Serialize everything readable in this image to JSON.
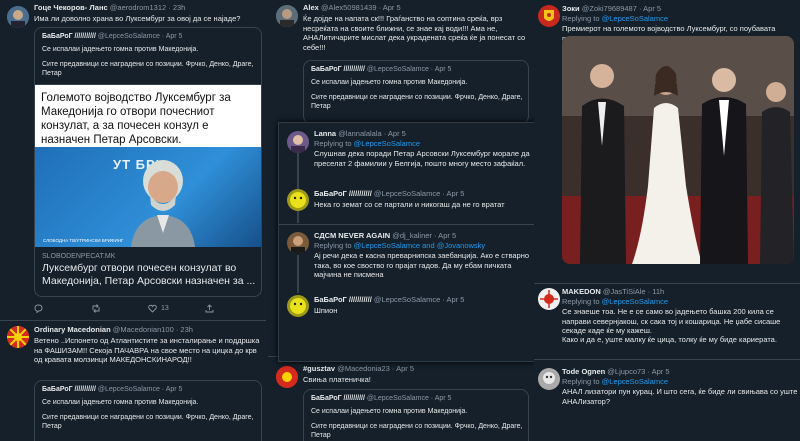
{
  "quoted": {
    "name": "БаБаРоГ ///////////",
    "handle": "@LepceSoSalamce · Apr 5",
    "line1": "Се испалаи јадењето гомна против Македонија.",
    "line2": "Сите предавници се наградени со позиции. Фрчко, Денко, Драге,",
    "line3": "Петар"
  },
  "left": {
    "t1": {
      "name": "Гоце Чекоров- Ланс",
      "meta": "@aerodrom1312 · 23h",
      "text": "Има ли доволно храна во Луксембург за овој да се најаде?",
      "card_headline": "Големото војводство Луксембург за Македонија го отвори почесниот конзулат, а за почесен конзул е назначен Петар Арсовски.",
      "card_caption": "СЛОБОДНА ТВ/УТРИНСКИ БРИФИНГ",
      "card_bg_text": "УТ БРИ",
      "card_domain": "SLOBODENPECAT.MK",
      "card_title": "Луксембург отвори почесен конзулат во Македонија, Петар Арсовски назначен за ..."
    },
    "t1_actions": {
      "reply": "",
      "retweet": "",
      "like": "13",
      "share": ""
    },
    "t2": {
      "name": "Ordinary Macedonian",
      "meta": "@Macedonian100 · 23h",
      "text": "Ветено ..Испонето од Атлантистите за инсталирање и поддршка на ФАШИЗАМ!! Секоја ПАЧАВРА на свое место на цицка до крв од кравата молзинци МАКЕДОНСКИНАРОД!!"
    }
  },
  "mid": {
    "t1": {
      "name": "Alex",
      "meta": "@Alex50981439 · Apr 5",
      "text": "Ќе дојде на напата ск!!! Граѓанство на соптина среќа, врз несреќата на своите ближни, се знае кај води!!! Ама не, АНАЛитичарите мислат дека украдената среќа ќе ја понесат со себе!!!"
    },
    "t2": {
      "name": "#gusztav",
      "meta": "@Macedonia23 · Apr 5",
      "text": "Свињa платеничка!"
    }
  },
  "popup": {
    "t1": {
      "name": "Lanna",
      "meta": "@lannalalala · Apr 5",
      "reply_prefix": "Replying to",
      "reply_handle": "@LepceSoSalamce",
      "text": "Слушнав дека поради Петар Арсовски Луксембург морале да преселат 2 фамилии у Белгија, пошто многу место зафаќал."
    },
    "t2": {
      "name": "БаБаРоГ ///////////",
      "meta": "@LepceSoSalamce · Apr 5",
      "text": "Нека го земат со се партали и никогаш да не го вратат"
    },
    "t3": {
      "name": "СДСМ NEVER AGAIN",
      "meta": "@dj_kaliner · Apr 5",
      "reply_prefix": "Replying to",
      "reply_handle": "@LepceSoSalamce and @Jovanowsky",
      "text": "Ај речи дека е касна преварнипска заебанција. Ако е стварно така, во кое своство го прајат гадов. Да му ебам пичката мајчина не писмена"
    },
    "t4": {
      "name": "БаБаРоГ ///////////",
      "meta": "@LepceSoSalamce · Apr 5",
      "text": "Шпион"
    }
  },
  "right": {
    "t1": {
      "name": "Зоки",
      "meta": "@Zoki79689487 · Apr 5",
      "reply_prefix": "Replying to",
      "reply_handle": "@LepceSoSalamce",
      "text": "Премиерот на големото војводство Луксембург, со поубавата половина."
    },
    "t2": {
      "name": "MAKEDON",
      "meta": "@JasTiSiAle · 11h",
      "reply_prefix": "Replying to",
      "reply_handle": "@LepceSoSalamce",
      "text1": "Се знаеше тоа. Не е се само во јадењето башка 200 кила се направи севернјакош, ск сака тој и кошарица. Не џабе сисаше секаде каде ќе му кажеш.",
      "text2": "Како и да е, уште малку ќе цица, толку ќе му биде кариерата."
    },
    "t3": {
      "name": "Tode Ognen",
      "meta": "@Ljupco73 · Apr 5",
      "reply_prefix": "Replying to",
      "reply_handle": "@LepceSoSalamce",
      "text": "АНАЛ лизатори пун курац. И што сега, ќе биде ли свињава со уште АНАЛизатор?"
    }
  },
  "colors": {
    "bg": "#15202b",
    "border": "#38444d",
    "muted": "#8b98a5",
    "link": "#1d9bf0"
  }
}
